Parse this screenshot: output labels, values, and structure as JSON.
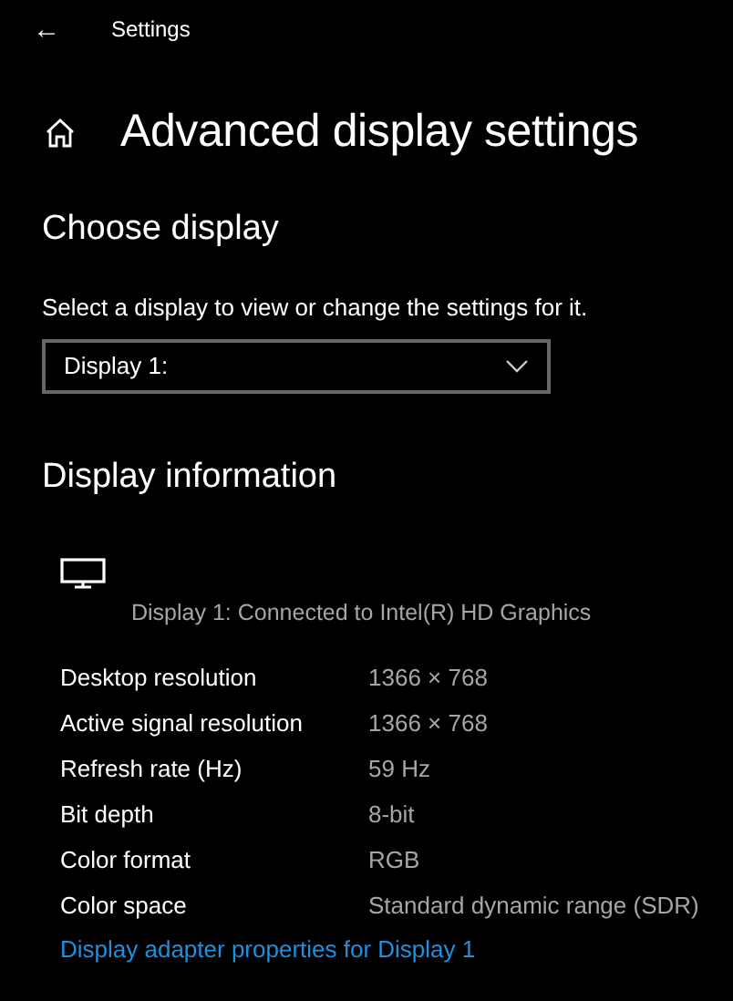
{
  "window": {
    "title": "Settings",
    "back": "←"
  },
  "page": {
    "title": "Advanced display settings"
  },
  "choose_display": {
    "heading": "Choose display",
    "description": "Select a display to view or change the settings for it.",
    "dropdown": {
      "value": "Display 1:"
    }
  },
  "display_information": {
    "heading": "Display information",
    "device": "Display 1: Connected to Intel(R) HD Graphics",
    "rows": [
      {
        "label": "Desktop resolution",
        "value": "1366 × 768"
      },
      {
        "label": "Active signal resolution",
        "value": "1366 × 768"
      },
      {
        "label": "Refresh rate (Hz)",
        "value": "59 Hz"
      },
      {
        "label": "Bit depth",
        "value": "8-bit"
      },
      {
        "label": "Color format",
        "value": "RGB"
      },
      {
        "label": "Color space",
        "value": "Standard dynamic range (SDR)"
      }
    ],
    "link": "Display adapter properties for Display 1"
  }
}
